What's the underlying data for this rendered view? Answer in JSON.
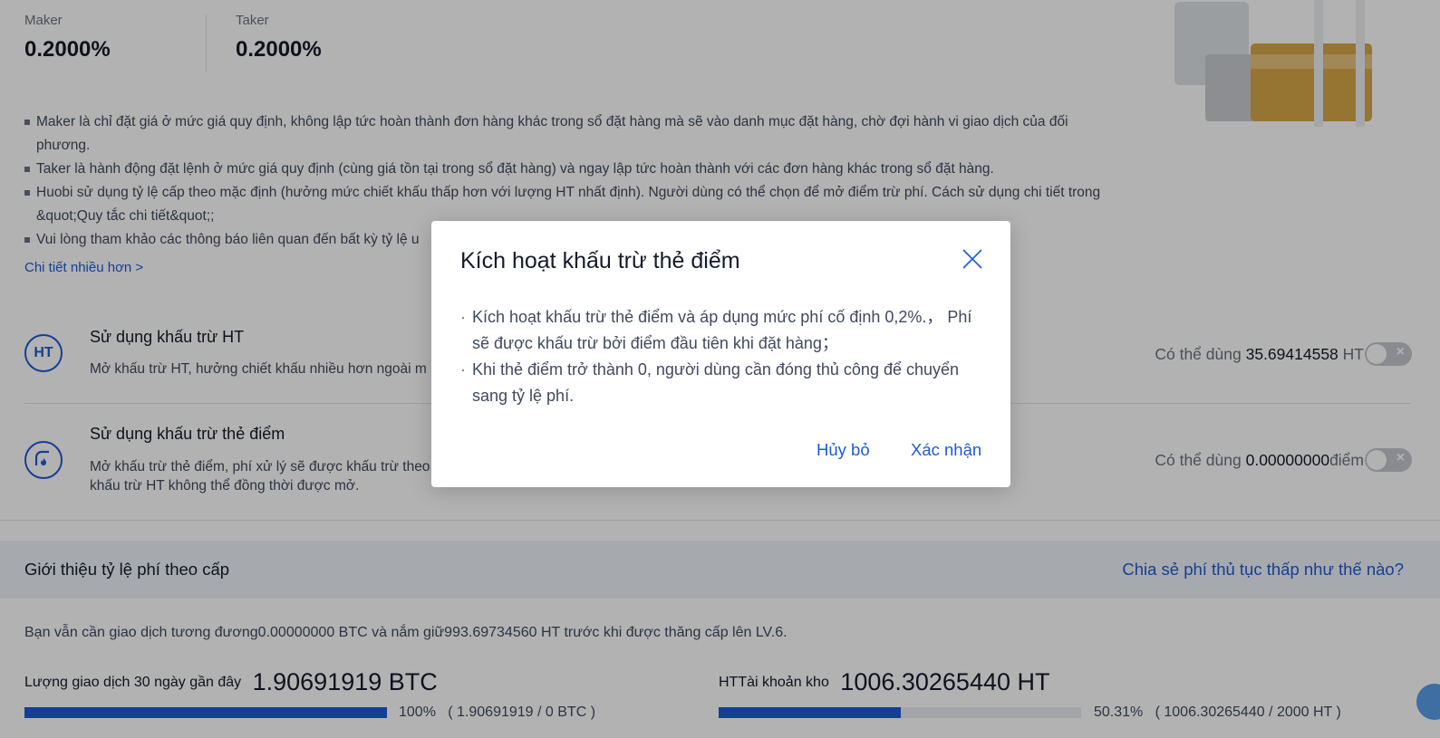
{
  "fees": {
    "maker_label": "Maker",
    "maker_value": "0.2000%",
    "taker_label": "Taker",
    "taker_value": "0.2000%"
  },
  "notes": [
    "Maker là chỉ đặt giá ở mức giá quy định, không lập tức hoàn thành đơn hàng khác trong sổ đặt hàng mà sẽ vào danh mục đặt hàng, chờ đợi hành vi giao dịch của đối phương.",
    "Taker là hành động đặt lệnh ở mức giá quy định (cùng giá tồn tại trong sổ đặt hàng) và ngay lập tức hoàn thành với các đơn hàng khác trong sổ đặt hàng.",
    "Huobi sử dụng tỷ lệ cấp theo mặc định (hưởng mức chiết khấu thấp hơn với lượng HT nhất định). Người dùng có thể chọn để mở điểm trừ phí. Cách sử dụng chi tiết trong &quot;Quy tắc chi tiết&quot;;",
    "Vui lòng tham khảo các thông báo liên quan đến bất kỳ tỷ lệ u"
  ],
  "more_link": "Chi tiết nhiều hơn >",
  "ht_row": {
    "icon_text": "HT",
    "title": "Sử dụng khấu trừ HT",
    "desc": "Mở khấu trừ HT, hưởng chiết khấu nhiều hơn ngoài m",
    "avail_label": "Có thể dùng",
    "avail_value": "35.69414558",
    "avail_unit": "HT"
  },
  "points_row": {
    "title": "Sử dụng khấu trừ thẻ điểm",
    "desc_line1": "Mở khấu trừ thẻ điểm, phí xử lý sẽ được khấu trừ theo",
    "desc_line2": "khấu trừ HT không thể đồng thời được mở.",
    "avail_label": "Có thể dùng",
    "avail_value": "0.00000000",
    "avail_unit": "điểm"
  },
  "toggle_icon": "close-x-icon",
  "tier": {
    "title": "Giới thiệu tỷ lệ phí theo cấp",
    "link": "Chia sẻ phí thủ tục thấp như thế nào?",
    "upgrade_text": "Bạn vẫn cần giao dịch tương đương0.00000000 BTC và nắm giữ993.69734560 HT trước khi được thăng cấp lên LV.6."
  },
  "stats": {
    "volume_label": "Lượng giao dịch 30 ngày gần đây",
    "volume_value": "1.90691919",
    "volume_unit": "BTC",
    "volume_progress": 1.0,
    "volume_pct_text": "100%",
    "volume_ratio_text": "( 1.90691919 / 0 BTC )",
    "holding_label": "HTTài khoản kho",
    "holding_value": "1006.30265440",
    "holding_unit": "HT",
    "holding_progress": 0.5031,
    "holding_pct_text": "50.31%",
    "holding_ratio_text": "( 1006.30265440 / 2000 HT )"
  },
  "modal": {
    "title": "Kích hoạt khấu trừ thẻ điểm",
    "close_icon": "close-icon",
    "body": [
      "Kích hoạt khấu trừ thẻ điểm và áp dụng mức phí cố định 0,2%.， Phí sẽ được khấu trừ bởi điểm đầu tiên khi đặt hàng；",
      "Khi thẻ điểm trở thành 0, người dùng cần đóng thủ công để chuyển sang tỷ lệ phí."
    ],
    "cancel_label": "Hủy bỏ",
    "confirm_label": "Xác nhận"
  },
  "colors": {
    "accent": "#1d5bd6",
    "overlay": "rgba(0,0,0,0.30)"
  }
}
